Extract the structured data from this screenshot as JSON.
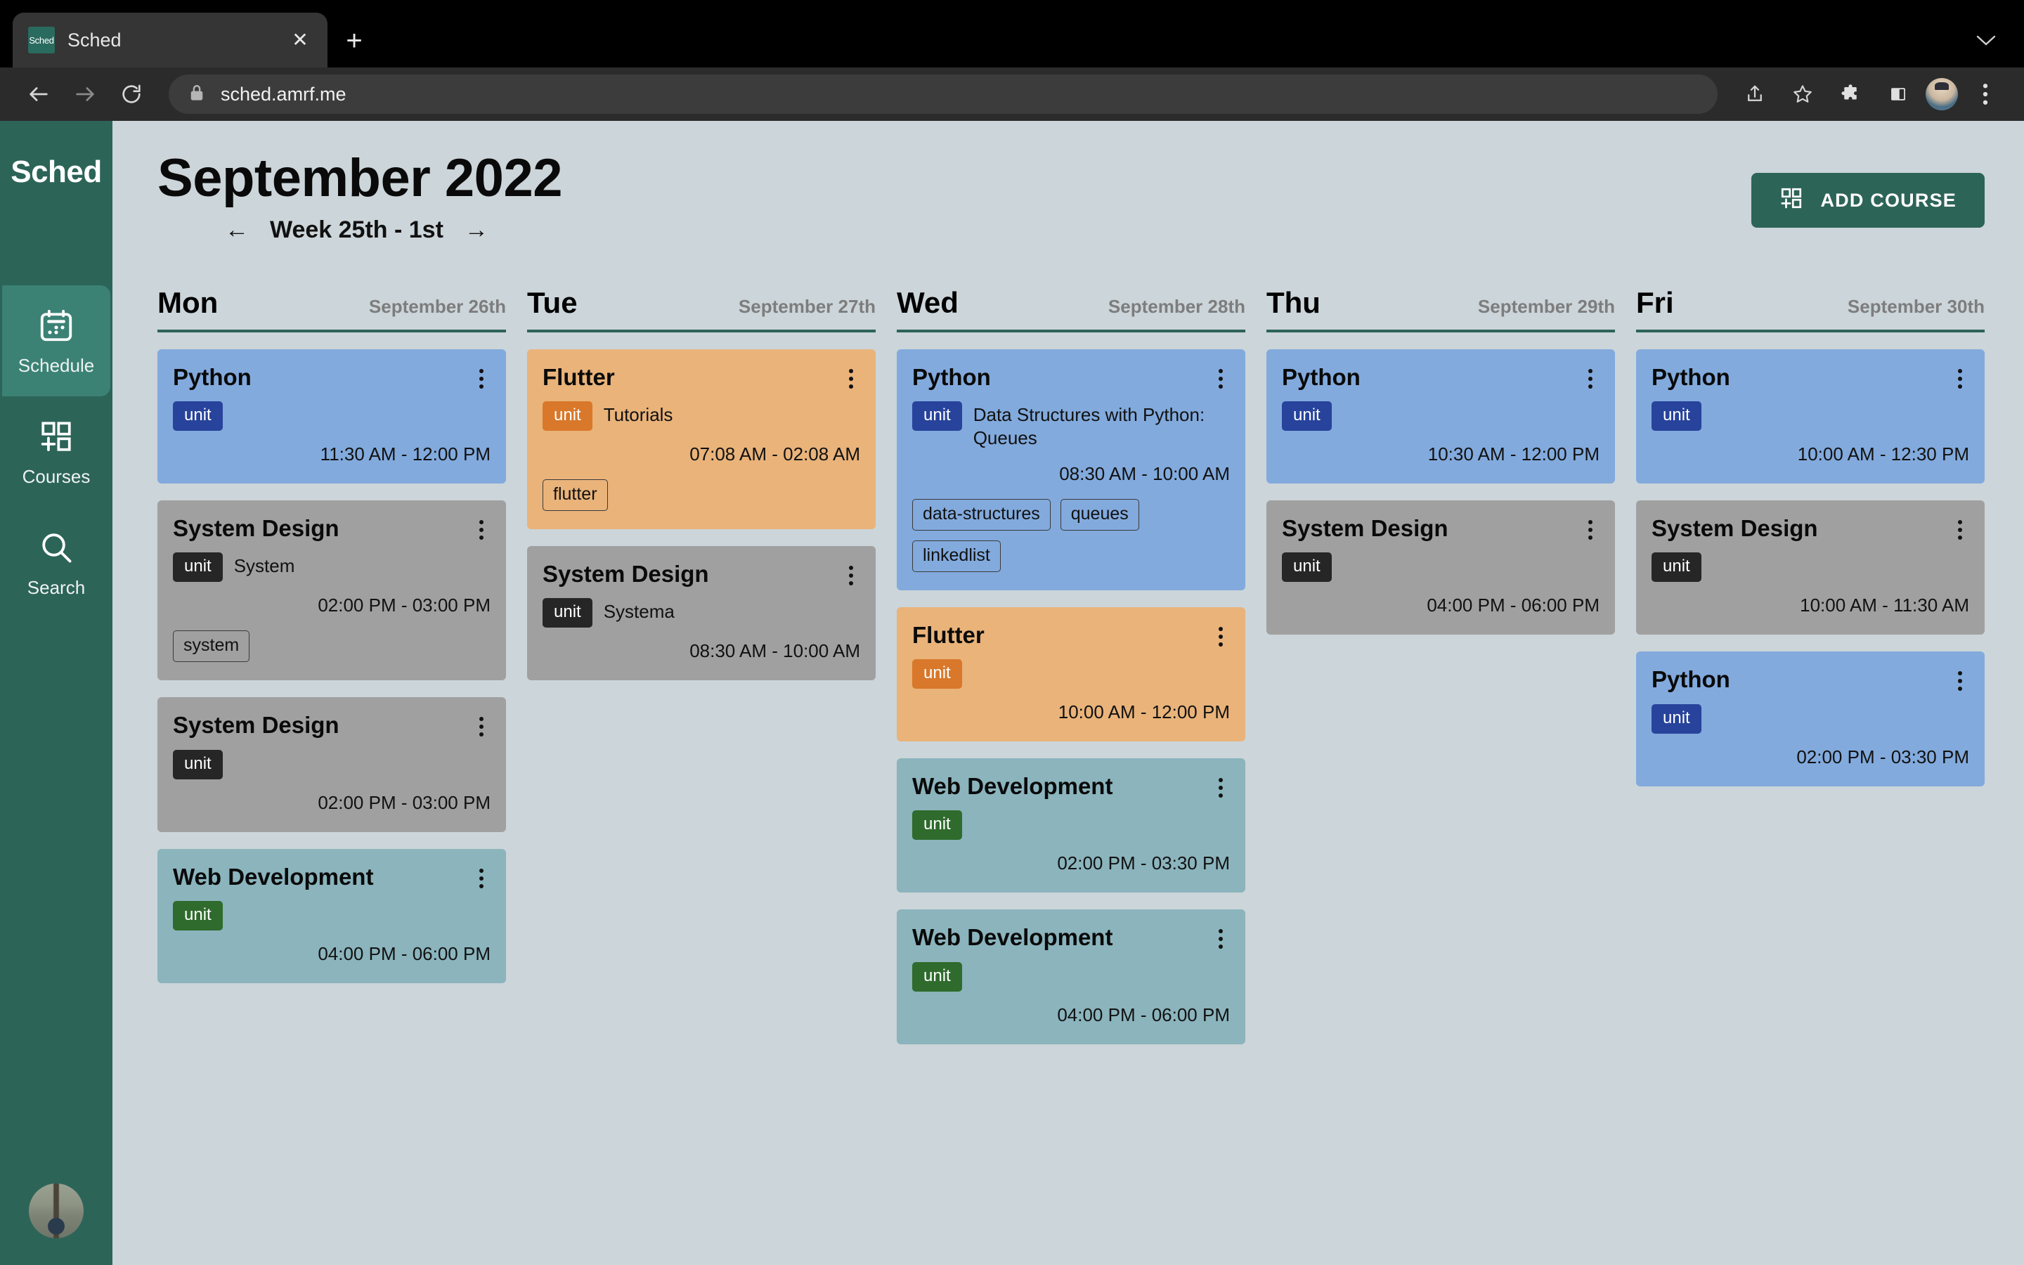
{
  "browser": {
    "tab": {
      "title": "Sched",
      "favicon_label": "Sched",
      "close_icon": "close-icon"
    },
    "new_tab_label": "+",
    "tabstrip_chevron": "⌄",
    "back_icon": "←",
    "forward_icon": "→",
    "reload_icon": "↻",
    "lock_icon": "lock-icon",
    "url": "sched.amrf.me",
    "share_icon": "share-icon",
    "bookmark_icon": "star-icon",
    "extensions_icon": "puzzle-icon",
    "sidepanel_icon": "side-panel-icon",
    "profile_icon": "profile-avatar",
    "menu_icon": "three-dot-menu-icon"
  },
  "sidebar": {
    "brand": "Sched",
    "items": [
      {
        "label": "Schedule",
        "icon": "calendar-icon",
        "active": true
      },
      {
        "label": "Courses",
        "icon": "grid-plus-icon",
        "active": false
      },
      {
        "label": "Search",
        "icon": "search-icon",
        "active": false
      }
    ],
    "avatar": "user-avatar"
  },
  "header": {
    "month_title": "September 2022",
    "prev_arrow": "←",
    "week_label": "Week 25th - 1st",
    "next_arrow": "→",
    "add_course_label": "ADD COURSE",
    "add_course_icon": "grid-plus-icon",
    "accent_color": "#2d6458"
  },
  "schedule": {
    "days": [
      {
        "name": "Mon",
        "date": "September 26th",
        "events": [
          {
            "course": "Python",
            "theme": "python",
            "unit_badge": "unit",
            "unit_text": "",
            "time": "11:30 AM - 12:00 PM",
            "tags": []
          },
          {
            "course": "System Design",
            "theme": "system",
            "unit_badge": "unit",
            "unit_text": "System",
            "time": "02:00 PM - 03:00 PM",
            "tags": [
              "system"
            ]
          },
          {
            "course": "System Design",
            "theme": "system",
            "unit_badge": "unit",
            "unit_text": "",
            "time": "02:00 PM - 03:00 PM",
            "tags": []
          },
          {
            "course": "Web Development",
            "theme": "web",
            "unit_badge": "unit",
            "unit_text": "",
            "time": "04:00 PM - 06:00 PM",
            "tags": []
          }
        ]
      },
      {
        "name": "Tue",
        "date": "September 27th",
        "events": [
          {
            "course": "Flutter",
            "theme": "flutter",
            "unit_badge": "unit",
            "unit_text": "Tutorials",
            "time": "07:08 AM - 02:08 AM",
            "tags": [
              "flutter"
            ]
          },
          {
            "course": "System Design",
            "theme": "system",
            "unit_badge": "unit",
            "unit_text": "Systema",
            "time": "08:30 AM - 10:00 AM",
            "tags": []
          }
        ]
      },
      {
        "name": "Wed",
        "date": "September 28th",
        "events": [
          {
            "course": "Python",
            "theme": "python",
            "unit_badge": "unit",
            "unit_text": "Data Structures with Python: Queues",
            "time": "08:30 AM - 10:00 AM",
            "tags": [
              "data-structures",
              "queues",
              "linkedlist"
            ]
          },
          {
            "course": "Flutter",
            "theme": "flutter",
            "unit_badge": "unit",
            "unit_text": "",
            "time": "10:00 AM - 12:00 PM",
            "tags": []
          },
          {
            "course": "Web Development",
            "theme": "web",
            "unit_badge": "unit",
            "unit_text": "",
            "time": "02:00 PM - 03:30 PM",
            "tags": []
          },
          {
            "course": "Web Development",
            "theme": "web",
            "unit_badge": "unit",
            "unit_text": "",
            "time": "04:00 PM - 06:00 PM",
            "tags": []
          }
        ]
      },
      {
        "name": "Thu",
        "date": "September 29th",
        "events": [
          {
            "course": "Python",
            "theme": "python",
            "unit_badge": "unit",
            "unit_text": "",
            "time": "10:30 AM - 12:00 PM",
            "tags": []
          },
          {
            "course": "System Design",
            "theme": "system",
            "unit_badge": "unit",
            "unit_text": "",
            "time": "04:00 PM - 06:00 PM",
            "tags": []
          }
        ]
      },
      {
        "name": "Fri",
        "date": "September 30th",
        "events": [
          {
            "course": "Python",
            "theme": "python",
            "unit_badge": "unit",
            "unit_text": "",
            "time": "10:00 AM - 12:30 PM",
            "tags": []
          },
          {
            "course": "System Design",
            "theme": "system",
            "unit_badge": "unit",
            "unit_text": "",
            "time": "10:00 AM - 11:30 AM",
            "tags": []
          },
          {
            "course": "Python",
            "theme": "python",
            "unit_badge": "unit",
            "unit_text": "",
            "time": "02:00 PM - 03:30 PM",
            "tags": []
          }
        ]
      }
    ],
    "card_colors": {
      "python": "#82aadd",
      "system": "#a0a0a0",
      "flutter": "#e9b37a",
      "web": "#8bb4bd"
    },
    "badge_colors": {
      "python": "#27439b",
      "system": "#262626",
      "flutter": "#d9782a",
      "web": "#2f6b2c"
    }
  }
}
